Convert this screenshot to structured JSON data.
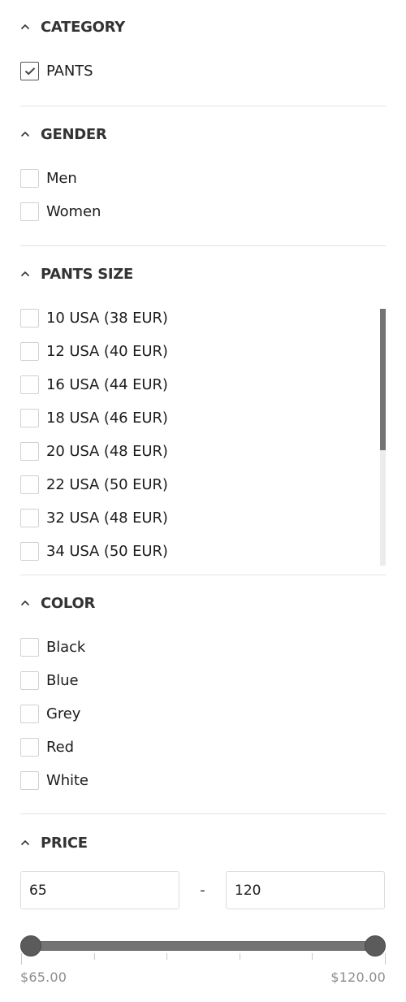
{
  "filters": {
    "category": {
      "title": "CATEGORY",
      "expanded": true,
      "options": [
        {
          "label": "PANTS",
          "checked": true
        }
      ]
    },
    "gender": {
      "title": "GENDER",
      "expanded": true,
      "options": [
        {
          "label": "Men",
          "checked": false
        },
        {
          "label": "Women",
          "checked": false
        }
      ]
    },
    "pants_size": {
      "title": "PANTS SIZE",
      "expanded": true,
      "options": [
        {
          "label": "10 USA (38 EUR)",
          "checked": false
        },
        {
          "label": "12 USA (40 EUR)",
          "checked": false
        },
        {
          "label": "16 USA (44 EUR)",
          "checked": false
        },
        {
          "label": "18 USA (46 EUR)",
          "checked": false
        },
        {
          "label": "20 USA (48 EUR)",
          "checked": false
        },
        {
          "label": "22 USA (50 EUR)",
          "checked": false
        },
        {
          "label": "32 USA (48 EUR)",
          "checked": false
        },
        {
          "label": "34 USA (50 EUR)",
          "checked": false
        }
      ],
      "scroll_visible_fraction": 0.55,
      "scroll_position": 0
    },
    "color": {
      "title": "COLOR",
      "expanded": true,
      "options": [
        {
          "label": "Black",
          "checked": false
        },
        {
          "label": "Blue",
          "checked": false
        },
        {
          "label": "Grey",
          "checked": false
        },
        {
          "label": "Red",
          "checked": false
        },
        {
          "label": "White",
          "checked": false
        }
      ]
    },
    "price": {
      "title": "PRICE",
      "expanded": true,
      "min_value": "65",
      "max_value": "120",
      "separator": "-",
      "range_min": 65,
      "range_max": 120,
      "selected_min": 65,
      "selected_max": 120,
      "tick_count": 6,
      "min_label": "$65.00",
      "max_label": "$120.00"
    }
  },
  "colors": {
    "accent": "#5b5b5b",
    "track": "#747474",
    "divider": "#e3e3e3",
    "title": "#333333",
    "muted_label": "#8d8d8d"
  }
}
